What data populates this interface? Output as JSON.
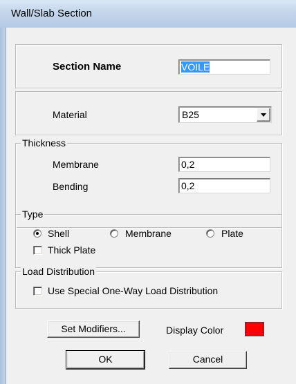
{
  "window": {
    "title": "Wall/Slab Section"
  },
  "section_name": {
    "label": "Section Name",
    "value": "VOILE"
  },
  "material": {
    "label": "Material",
    "value": "B25"
  },
  "thickness": {
    "group_label": "Thickness",
    "membrane_label": "Membrane",
    "membrane_value": "0,2",
    "bending_label": "Bending",
    "bending_value": "0,2"
  },
  "type": {
    "group_label": "Type",
    "options": [
      {
        "label": "Shell",
        "selected": true
      },
      {
        "label": "Membrane",
        "selected": false
      },
      {
        "label": "Plate",
        "selected": false
      }
    ],
    "thick_plate_label": "Thick Plate",
    "thick_plate_checked": false
  },
  "load_distribution": {
    "group_label": "Load Distribution",
    "option_label": "Use Special One-Way Load Distribution",
    "checked": false
  },
  "buttons": {
    "set_modifiers": "Set Modifiers...",
    "ok": "OK",
    "cancel": "Cancel"
  },
  "display_color": {
    "label": "Display Color",
    "color": "#ff0000"
  },
  "colors": {
    "titlebar": "#c4d6ec",
    "selection": "#3399ff",
    "dialog_bg": "#f0f0f0"
  }
}
